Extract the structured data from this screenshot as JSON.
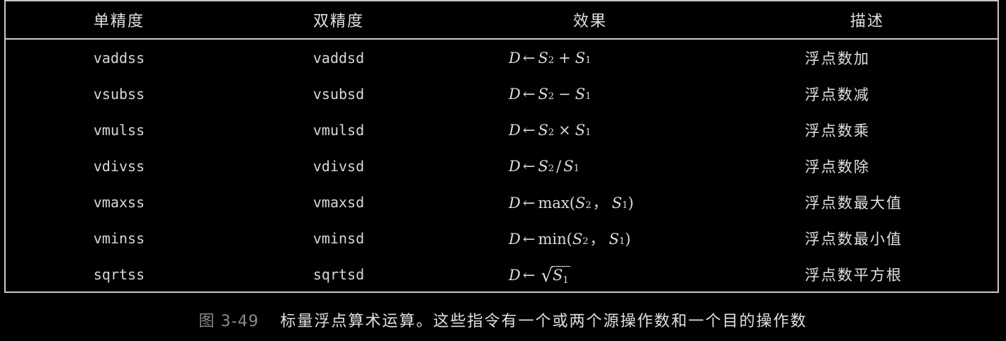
{
  "table": {
    "headers": [
      "单精度",
      "双精度",
      "效果",
      "描述"
    ],
    "rows": [
      {
        "single": "vaddss",
        "double": "vaddsd",
        "effect": {
          "d": "D",
          "arrow": "←",
          "s2": "S",
          "s2_sub": "2",
          "op": "+",
          "s1": "S",
          "s1_sub": "1"
        },
        "description": "浮点数加"
      },
      {
        "single": "vsubss",
        "double": "vsubsd",
        "effect": {
          "d": "D",
          "arrow": "←",
          "s2": "S",
          "s2_sub": "2",
          "op": "−",
          "s1": "S",
          "s1_sub": "1"
        },
        "description": "浮点数减"
      },
      {
        "single": "vmulss",
        "double": "vmulsd",
        "effect": {
          "d": "D",
          "arrow": "←",
          "s2": "S",
          "s2_sub": "2",
          "op": "×",
          "s1": "S",
          "s1_sub": "1"
        },
        "description": "浮点数乘"
      },
      {
        "single": "vdivss",
        "double": "vdivsd",
        "effect": {
          "d": "D",
          "arrow": "←",
          "s2": "S",
          "s2_sub": "2",
          "op": "/",
          "s1": "S",
          "s1_sub": "1"
        },
        "description": "浮点数除"
      },
      {
        "single": "vmaxss",
        "double": "vmaxsd",
        "effect": {
          "d": "D",
          "arrow": "←",
          "fn": "max(",
          "s2": "S",
          "s2_sub": "2",
          "sep": "，",
          "s1": "S",
          "s1_sub": "1",
          "close": ")"
        },
        "description": "浮点数最大值"
      },
      {
        "single": "vminss",
        "double": "vminsd",
        "effect": {
          "d": "D",
          "arrow": "←",
          "fn": "min(",
          "s2": "S",
          "s2_sub": "2",
          "sep": "，",
          "s1": "S",
          "s1_sub": "1",
          "close": ")"
        },
        "description": "浮点数最小值"
      },
      {
        "single": "sqrtss",
        "double": "sqrtsd",
        "effect": {
          "d": "D",
          "arrow": "←",
          "sqrt": "√",
          "s1": "S",
          "s1_sub": "1"
        },
        "description": "浮点数平方根"
      }
    ]
  },
  "caption": {
    "figure_number": "图 3-49",
    "text": "标量浮点算术运算。这些指令有一个或两个源操作数和一个目的操作数"
  }
}
